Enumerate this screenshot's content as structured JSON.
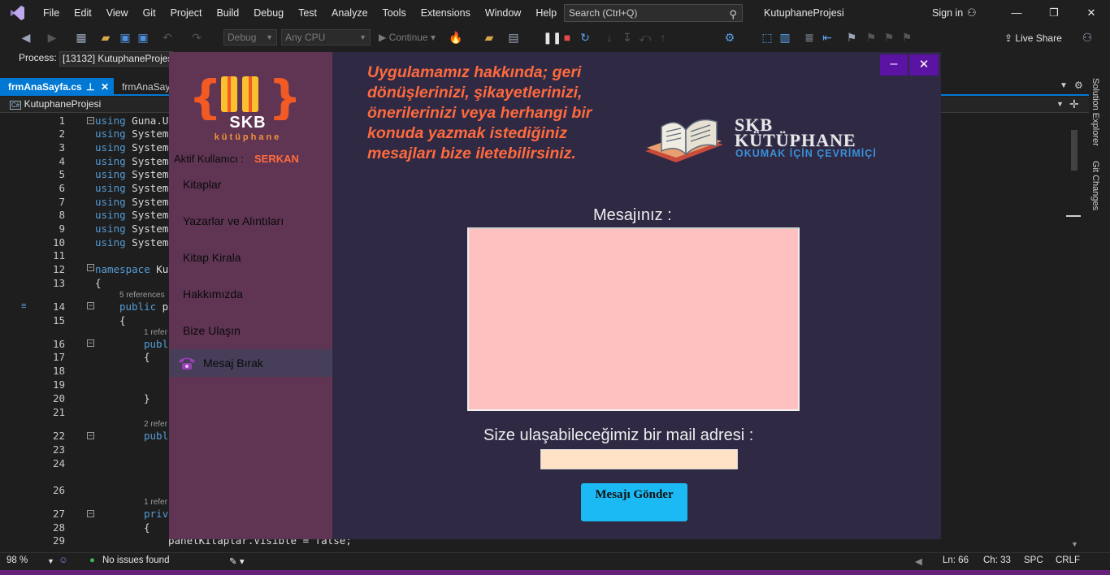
{
  "ide": {
    "menu": [
      "File",
      "Edit",
      "View",
      "Git",
      "Project",
      "Build",
      "Debug",
      "Test",
      "Analyze",
      "Tools",
      "Extensions",
      "Window",
      "Help"
    ],
    "search_placeholder": "Search (Ctrl+Q)",
    "project_title": "KutuphaneProjesi",
    "sign_in": "Sign in",
    "toolbar": {
      "config": "Debug",
      "platform": "Any CPU",
      "continue": "Continue",
      "live_share": "Live Share"
    },
    "process_label": "Process:",
    "process_value": "[13132] KutuphaneProjesi",
    "tabs": [
      "frmAnaSayfa.cs",
      "frmAnaSayf"
    ],
    "nav_project": "KutuphaneProjesi",
    "side_panels": [
      "Solution Explorer",
      "Git Changes"
    ],
    "status": {
      "zoom": "98 %",
      "issues": "No issues found",
      "line": "Ln: 66",
      "col": "Ch: 33",
      "spc": "SPC",
      "eol": "CRLF"
    }
  },
  "code": {
    "lines": [
      {
        "n": "1",
        "kw": "using",
        "text": " Guna.UI"
      },
      {
        "n": "2",
        "kw": "using",
        "text": " System"
      },
      {
        "n": "3",
        "kw": "using",
        "text": " System"
      },
      {
        "n": "4",
        "kw": "using",
        "text": " System"
      },
      {
        "n": "5",
        "kw": "using",
        "text": " System"
      },
      {
        "n": "6",
        "kw": "using",
        "text": " System"
      },
      {
        "n": "7",
        "kw": "using",
        "text": " System"
      },
      {
        "n": "8",
        "kw": "using",
        "text": " System"
      },
      {
        "n": "9",
        "kw": "using",
        "text": " System"
      },
      {
        "n": "10",
        "kw": "using",
        "text": " System"
      },
      {
        "n": "11",
        "kw": "",
        "text": ""
      },
      {
        "n": "12",
        "kw": "namespace",
        "text": " Kut"
      },
      {
        "n": "13",
        "kw": "",
        "text": "{"
      },
      {
        "n": "14",
        "kw": "public",
        "text": " pa"
      },
      {
        "n": "15",
        "kw": "",
        "text": "{"
      },
      {
        "n": "16",
        "kw": "publi",
        "text": ""
      },
      {
        "n": "17",
        "kw": "",
        "text": "{"
      },
      {
        "n": "18",
        "kw": "",
        "text": ""
      },
      {
        "n": "19",
        "kw": "",
        "text": ""
      },
      {
        "n": "20",
        "kw": "",
        "text": "}"
      },
      {
        "n": "21",
        "kw": "",
        "text": ""
      },
      {
        "n": "22",
        "kw": "publi",
        "text": ""
      },
      {
        "n": "23",
        "kw": "",
        "text": ""
      },
      {
        "n": "24",
        "kw": "",
        "text": ""
      },
      {
        "n": "26",
        "kw": "",
        "text": ""
      },
      {
        "n": "27",
        "kw": "priva",
        "text": ""
      },
      {
        "n": "28",
        "kw": "",
        "text": "{"
      },
      {
        "n": "29",
        "kw": "",
        "text": "panelKitaplar.Visible = false;"
      }
    ],
    "refs": [
      "5 references",
      "1 refer",
      "2 refer",
      "1 refer"
    ]
  },
  "app": {
    "logo_text": "SKB",
    "logo_sub": "kütüphane",
    "active_user_label": "Aktif Kullanıcı :",
    "active_user_name": "SERKAN",
    "nav": [
      "Kitaplar",
      "Yazarlar ve Alıntıları",
      "Kitap Kirala",
      "Hakkımızda",
      "Bize Ulaşın",
      "Mesaj Bırak"
    ],
    "intro": "Uygulamamız hakkında; geri dönüşlerinizi, şikayetlerinizi, önerilerinizi veya herhangi bir konuda yazmak istediğiniz mesajları bize iletebilirsiniz.",
    "brand_title_1": "SKB",
    "brand_title_2": "KÜTÜPHANE",
    "brand_tagline": "OKUMAK İÇİN ÇEVRİMİÇİ",
    "message_label": "Mesajınız :",
    "message_value": "",
    "mail_label": "Size ulaşabileceğimiz bir mail adresi :",
    "mail_value": "",
    "send_button": "Mesajı Gönder",
    "min_button": "–",
    "close_button": "✕",
    "colors": {
      "sidebar": "#5f3553",
      "form": "#2f2944",
      "accent": "#ff6a3d",
      "button": "#1bbaf4",
      "window_ctl": "#5b13a4"
    }
  }
}
